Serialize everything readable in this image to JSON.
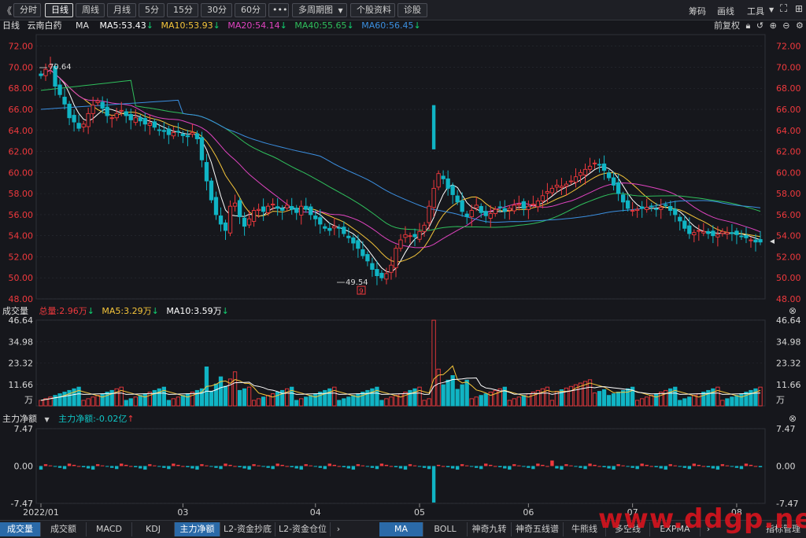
{
  "toolbar": {
    "back": "《",
    "tabs": [
      "分时",
      "日线",
      "周线",
      "月线",
      "5分",
      "15分",
      "30分",
      "60分",
      "•••",
      "多周期图",
      "个股资料",
      "诊股"
    ],
    "active_tab": "日线",
    "right_items": [
      "筹码",
      "画线",
      "工具"
    ]
  },
  "kline_legend": {
    "period": "日线",
    "stock_name": "云南白药",
    "ma_label": "MA",
    "ma5": "MA5:53.43",
    "ma10": "MA10:53.93",
    "ma20": "MA20:54.14",
    "ma40": "MA40:55.65",
    "ma60": "MA60:56.45",
    "adjust": "前复权"
  },
  "volume_legend": {
    "title": "成交量",
    "total": "总量:2.96万",
    "ma5": "MA5:3.29万",
    "ma10": "MA10:3.59万"
  },
  "flow_legend": {
    "title": "主力净额",
    "value": "主力净额:-0.02亿"
  },
  "colors": {
    "up": "#f0393d",
    "down": "#10b4c4",
    "ma5": "#ffffff",
    "ma10": "#f5c53a",
    "ma20": "#e044c0",
    "ma40": "#2fbf5c",
    "ma60": "#3b8fe0",
    "background": "#16171c",
    "active_tab": "#2b6aa8"
  },
  "annotations": {
    "high": "70.64",
    "low": "49.54",
    "event_marker": "9"
  },
  "bottom_tabs_left": [
    "成交量",
    "成交额",
    "MACD",
    "KDJ",
    "主力净额",
    "L2-资金抄底",
    "L2-资金仓位"
  ],
  "bottom_tabs_right": [
    "MA",
    "BOLL",
    "神奇九转",
    "神奇五线谱",
    "牛熊线",
    "多空线",
    "EXPMA"
  ],
  "active_left_tab": "主力净额",
  "active_right_tab": "MA",
  "bottom_right_button": "指标管理",
  "watermark": "www.ddgp.net",
  "chart_data": [
    {
      "type": "candlestick",
      "title": "日线",
      "x_ticks": [
        "2022/01",
        "03",
        "04",
        "05",
        "06",
        "07",
        "08"
      ],
      "y_ticks": [
        72.0,
        70.0,
        68.0,
        66.0,
        64.0,
        62.0,
        60.0,
        58.0,
        56.0,
        54.0,
        52.0,
        50.0,
        48.0
      ],
      "ylim": [
        48,
        72.5
      ],
      "closes": [
        69.2,
        69.8,
        70.2,
        68.2,
        67.4,
        66.5,
        65.2,
        64.8,
        64.2,
        64.6,
        65.6,
        66.4,
        66.8,
        66.1,
        65.4,
        65.2,
        65.6,
        65.9,
        65.4,
        65.0,
        65.2,
        64.9,
        64.6,
        64.7,
        64.3,
        64.0,
        63.9,
        63.6,
        63.8,
        63.9,
        63.5,
        63.4,
        63.8,
        63.2,
        61.2,
        59.2,
        57.4,
        56.0,
        55.1,
        54.5,
        56.8,
        57.1,
        55.8,
        54.9,
        55.6,
        56.4,
        56.5,
        56.3,
        56.8,
        57.0,
        56.6,
        56.4,
        56.9,
        56.5,
        56.2,
        56.8,
        56.5,
        56.0,
        55.6,
        55.1,
        54.7,
        54.5,
        54.9,
        54.7,
        54.2,
        53.8,
        53.3,
        52.8,
        52.1,
        51.6,
        50.8,
        50.2,
        50.0,
        50.4,
        51.2,
        52.8,
        53.6,
        54.1,
        54.0,
        53.9,
        54.4,
        55.0,
        56.8,
        58.5,
        59.9,
        59.4,
        58.5,
        57.9,
        57.2,
        56.3,
        55.8,
        56.4,
        56.9,
        56.2,
        55.9,
        56.1,
        56.5,
        56.7,
        56.3,
        56.6,
        56.9,
        57.0,
        56.6,
        56.8,
        57.0,
        57.3,
        57.8,
        58.2,
        58.5,
        58.8,
        58.7,
        58.9,
        59.2,
        59.6,
        60.0,
        60.3,
        60.6,
        60.9,
        60.7,
        60.2,
        59.5,
        58.8,
        58.0,
        57.2,
        56.6,
        56.4,
        56.5,
        56.6,
        56.7,
        56.8,
        56.5,
        56.7,
        56.9,
        56.4,
        56.0,
        55.4,
        54.7,
        54.2,
        54.3,
        54.5,
        54.4,
        54.2,
        54.0,
        54.1,
        54.4,
        54.3,
        54.2,
        54.1,
        53.9,
        53.8,
        53.6,
        53.4,
        53.4
      ]
    },
    {
      "type": "bar",
      "title": "成交量",
      "y_ticks": [
        46.64,
        34.98,
        23.32,
        11.66
      ],
      "unit": "万",
      "ylim": [
        0,
        46.64
      ]
    },
    {
      "type": "bar",
      "title": "主力净额",
      "y_ticks": [
        7.47,
        0.0,
        -7.47
      ],
      "ylim": [
        -7.47,
        7.47
      ]
    }
  ]
}
